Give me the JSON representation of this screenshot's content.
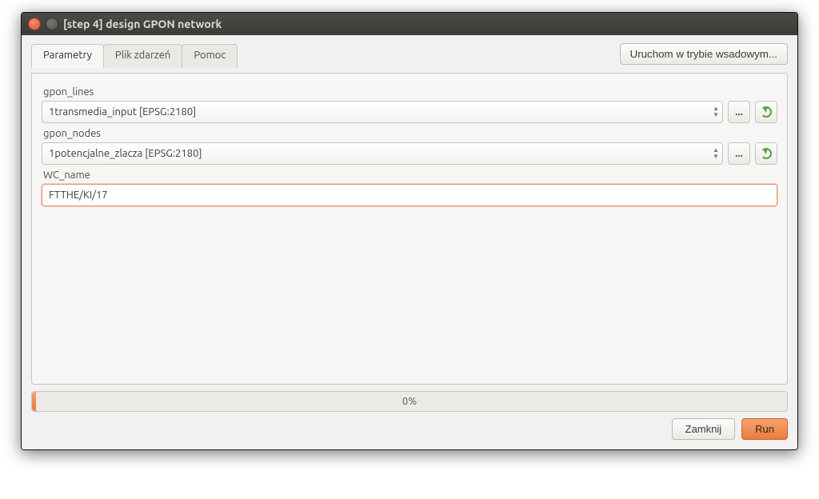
{
  "window": {
    "title": "[step 4] design GPON network"
  },
  "tabs": {
    "items": [
      {
        "label": "Parametry"
      },
      {
        "label": "Plik zdarzeń"
      },
      {
        "label": "Pomoc"
      }
    ],
    "batch_button": "Uruchom w trybie wsadowym..."
  },
  "params": {
    "gpon_lines": {
      "label": "gpon_lines",
      "value": "1transmedia_input [EPSG:2180]",
      "browse": "...",
      "reload": "reload"
    },
    "gpon_nodes": {
      "label": "gpon_nodes",
      "value": "1potencjalne_zlacza [EPSG:2180]",
      "browse": "...",
      "reload": "reload"
    },
    "wc_name": {
      "label": "WC_name",
      "value": "FTTHE/KI/17"
    }
  },
  "progress": {
    "text": "0%"
  },
  "footer": {
    "close": "Zamknij",
    "run": "Run"
  }
}
